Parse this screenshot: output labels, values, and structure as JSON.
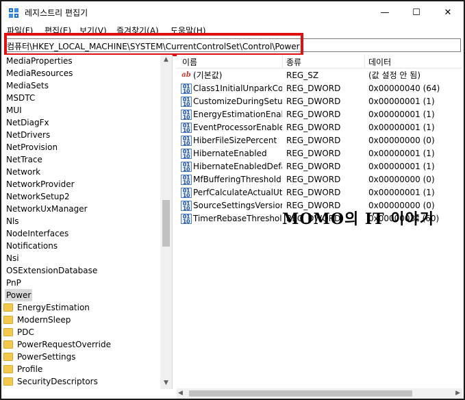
{
  "window": {
    "title": "레지스트리 편집기",
    "min_glyph": "—",
    "max_glyph": "☐",
    "close_glyph": "✕"
  },
  "menu": [
    "파일(F)",
    "편집(E)",
    "보기(V)",
    "즐겨찾기(A)",
    "도움말(H)"
  ],
  "address": "컴퓨터\\HKEY_LOCAL_MACHINE\\SYSTEM\\CurrentControlSet\\Control\\Power",
  "colors": {
    "highlight_box": "#e01010",
    "folder": "#f2c94c",
    "selected_bg": "#d9d9d9"
  },
  "tree": {
    "items": [
      {
        "label": "MediaProperties",
        "child": false
      },
      {
        "label": "MediaResources",
        "child": false
      },
      {
        "label": "MediaSets",
        "child": false
      },
      {
        "label": "MSDTC",
        "child": false
      },
      {
        "label": "MUI",
        "child": false
      },
      {
        "label": "NetDiagFx",
        "child": false
      },
      {
        "label": "NetDrivers",
        "child": false
      },
      {
        "label": "NetProvision",
        "child": false
      },
      {
        "label": "NetTrace",
        "child": false
      },
      {
        "label": "Network",
        "child": false
      },
      {
        "label": "NetworkProvider",
        "child": false
      },
      {
        "label": "NetworkSetup2",
        "child": false
      },
      {
        "label": "NetworkUxManager",
        "child": false
      },
      {
        "label": "Nls",
        "child": false
      },
      {
        "label": "NodeInterfaces",
        "child": false
      },
      {
        "label": "Notifications",
        "child": false
      },
      {
        "label": "Nsi",
        "child": false
      },
      {
        "label": "OSExtensionDatabase",
        "child": false
      },
      {
        "label": "PnP",
        "child": false
      },
      {
        "label": "Power",
        "child": false,
        "selected": true
      },
      {
        "label": "EnergyEstimation",
        "child": true
      },
      {
        "label": "ModernSleep",
        "child": true
      },
      {
        "label": "PDC",
        "child": true
      },
      {
        "label": "PowerRequestOverride",
        "child": true
      },
      {
        "label": "PowerSettings",
        "child": true
      },
      {
        "label": "Profile",
        "child": true
      },
      {
        "label": "SecurityDescriptors",
        "child": true
      }
    ]
  },
  "values": {
    "headers": {
      "name": "이름",
      "type": "종류",
      "data": "데이터"
    },
    "rows": [
      {
        "icon": "string-value-icon",
        "name": "(기본값)",
        "type": "REG_SZ",
        "data": "(값 설정 안 됨)"
      },
      {
        "icon": "binary-value-icon",
        "name": "Class1InitialUnparkCo...",
        "type": "REG_DWORD",
        "data": "0x00000040 (64)"
      },
      {
        "icon": "binary-value-icon",
        "name": "CustomizeDuringSetup",
        "type": "REG_DWORD",
        "data": "0x00000001 (1)"
      },
      {
        "icon": "binary-value-icon",
        "name": "EnergyEstimationEnab...",
        "type": "REG_DWORD",
        "data": "0x00000001 (1)"
      },
      {
        "icon": "binary-value-icon",
        "name": "EventProcessorEnabled",
        "type": "REG_DWORD",
        "data": "0x00000001 (1)"
      },
      {
        "icon": "binary-value-icon",
        "name": "HiberFileSizePercent",
        "type": "REG_DWORD",
        "data": "0x00000000 (0)"
      },
      {
        "icon": "binary-value-icon",
        "name": "HibernateEnabled",
        "type": "REG_DWORD",
        "data": "0x00000001 (1)"
      },
      {
        "icon": "binary-value-icon",
        "name": "HibernateEnabledDefa...",
        "type": "REG_DWORD",
        "data": "0x00000001 (1)"
      },
      {
        "icon": "binary-value-icon",
        "name": "MfBufferingThreshold",
        "type": "REG_DWORD",
        "data": "0x00000000 (0)"
      },
      {
        "icon": "binary-value-icon",
        "name": "PerfCalculateActualUti...",
        "type": "REG_DWORD",
        "data": "0x00000001 (1)"
      },
      {
        "icon": "binary-value-icon",
        "name": "SourceSettingsVersion",
        "type": "REG_DWORD",
        "data": "0x00000000 (0)"
      },
      {
        "icon": "binary-value-icon",
        "name": "TimerRebaseThreshold...",
        "type": "REG_DWORD",
        "data": "0x0000003c (60)"
      }
    ]
  },
  "watermark": "MOMO의 IT 이야기"
}
